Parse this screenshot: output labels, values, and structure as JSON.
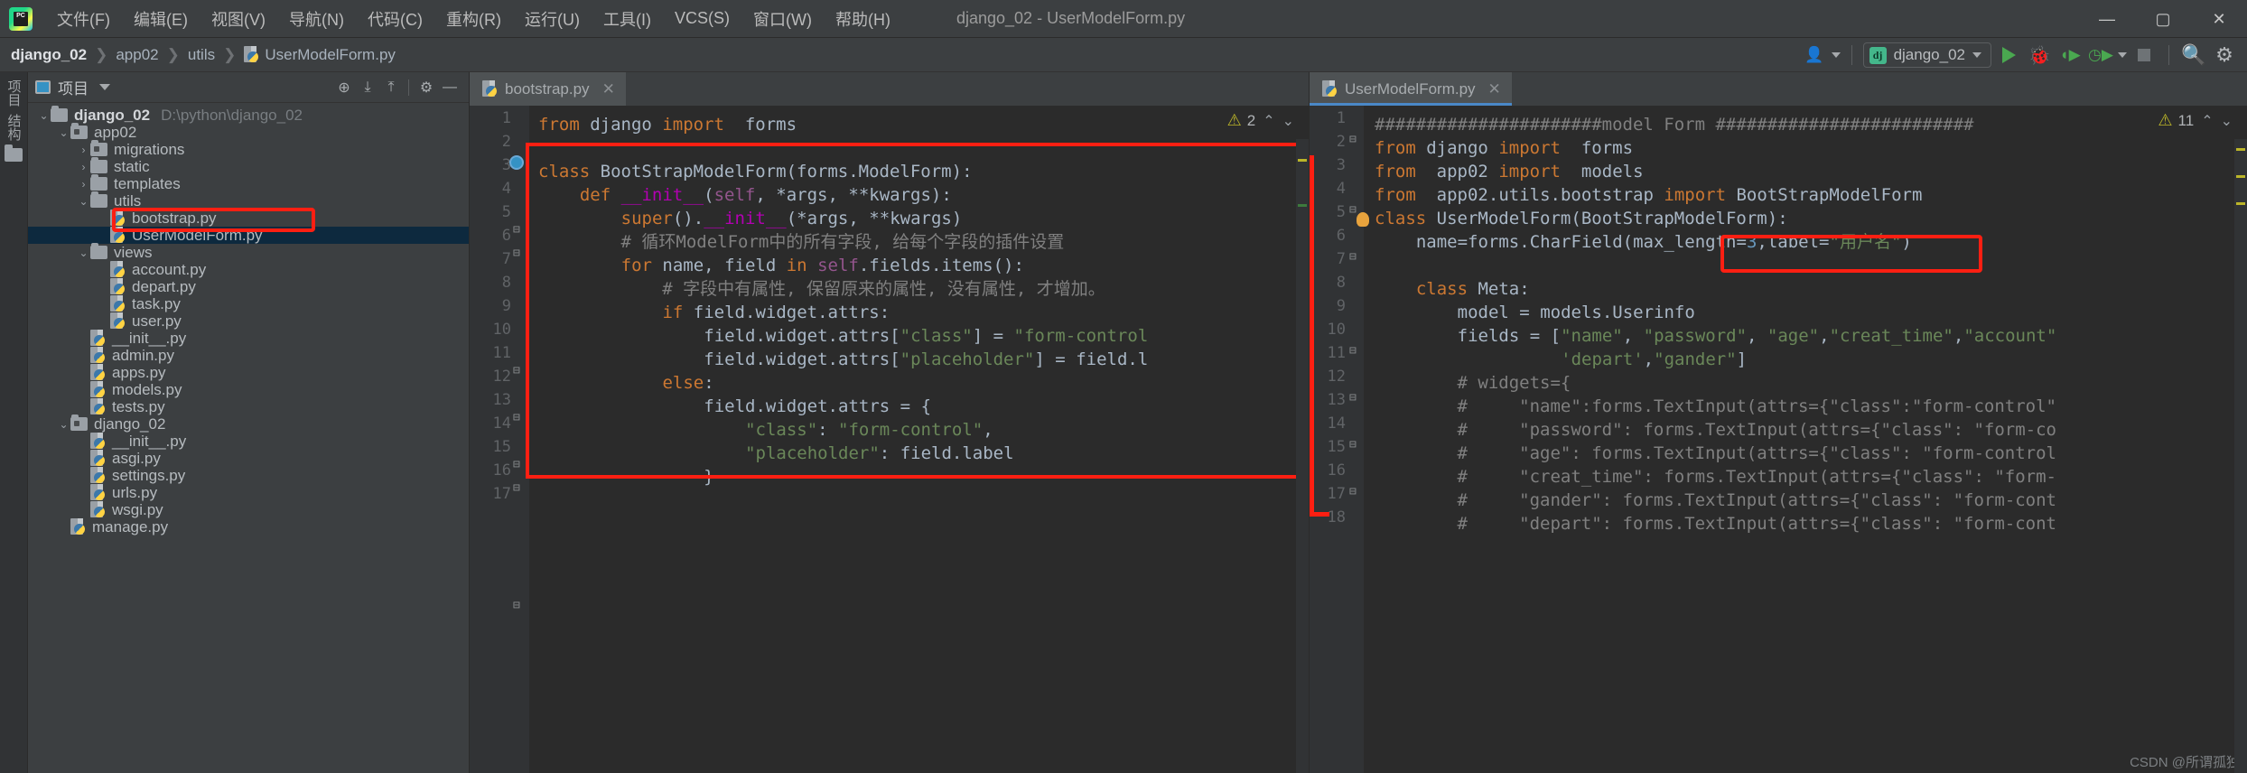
{
  "window": {
    "title": "django_02 - UserModelForm.py",
    "minimize": "—",
    "maximize": "▢",
    "close": "✕"
  },
  "menubar": {
    "logo_text": "PC",
    "items": [
      "文件(F)",
      "编辑(E)",
      "视图(V)",
      "导航(N)",
      "代码(C)",
      "重构(R)",
      "运行(U)",
      "工具(I)",
      "VCS(S)",
      "窗口(W)",
      "帮助(H)"
    ]
  },
  "breadcrumb": {
    "project": "django_02",
    "app": "app02",
    "folder": "utils",
    "file": "UserModelForm.py",
    "separator": "❯"
  },
  "toolbar": {
    "account_icon": "user-icon",
    "run_config": {
      "badge": "dj",
      "label": "django_02",
      "dropdown_icon": "chevron-down-icon"
    },
    "run_icon": "run-play-icon",
    "debug_icon": "debug-bug-icon",
    "coverage_icon": "run-coverage-icon",
    "profile_icon": "profile-icon",
    "more_icon": "chevron-down-icon",
    "stop_icon": "stop-square-icon",
    "search_icon": "search-icon",
    "settings_icon": "gear-icon"
  },
  "left_strip": {
    "project_tab": "项目",
    "structure_tab": "结构",
    "favorites_icon": "folder-icon"
  },
  "project_panel": {
    "title": "项目",
    "dropdown_icon": "chevron-down-icon",
    "actions": [
      "locate-icon",
      "expand-all-icon",
      "collapse-all-icon",
      "gear-icon",
      "minimize-icon"
    ],
    "tree": [
      {
        "label": "django_02",
        "path": "D:\\python\\django_02",
        "depth": 0,
        "arrow": "down",
        "icon": "folder",
        "bold": true
      },
      {
        "label": "app02",
        "path": "",
        "depth": 1,
        "arrow": "down",
        "icon": "module-folder",
        "bold": false
      },
      {
        "label": "migrations",
        "path": "",
        "depth": 2,
        "arrow": "right",
        "icon": "module-folder",
        "bold": false
      },
      {
        "label": "static",
        "path": "",
        "depth": 2,
        "arrow": "right",
        "icon": "folder",
        "bold": false
      },
      {
        "label": "templates",
        "path": "",
        "depth": 2,
        "arrow": "right",
        "icon": "folder",
        "bold": false
      },
      {
        "label": "utils",
        "path": "",
        "depth": 2,
        "arrow": "down",
        "icon": "folder",
        "bold": false
      },
      {
        "label": "bootstrap.py",
        "path": "",
        "depth": 3,
        "arrow": "none",
        "icon": "python",
        "bold": false,
        "highlight": true
      },
      {
        "label": "UserModelForm.py",
        "path": "",
        "depth": 3,
        "arrow": "none",
        "icon": "python",
        "bold": false,
        "selected": true
      },
      {
        "label": "views",
        "path": "",
        "depth": 2,
        "arrow": "down",
        "icon": "folder",
        "bold": false
      },
      {
        "label": "account.py",
        "path": "",
        "depth": 3,
        "arrow": "none",
        "icon": "python",
        "bold": false
      },
      {
        "label": "depart.py",
        "path": "",
        "depth": 3,
        "arrow": "none",
        "icon": "python",
        "bold": false
      },
      {
        "label": "task.py",
        "path": "",
        "depth": 3,
        "arrow": "none",
        "icon": "python",
        "bold": false
      },
      {
        "label": "user.py",
        "path": "",
        "depth": 3,
        "arrow": "none",
        "icon": "python",
        "bold": false
      },
      {
        "label": "__init__.py",
        "path": "",
        "depth": 2,
        "arrow": "none",
        "icon": "python",
        "bold": false
      },
      {
        "label": "admin.py",
        "path": "",
        "depth": 2,
        "arrow": "none",
        "icon": "python",
        "bold": false
      },
      {
        "label": "apps.py",
        "path": "",
        "depth": 2,
        "arrow": "none",
        "icon": "python",
        "bold": false
      },
      {
        "label": "models.py",
        "path": "",
        "depth": 2,
        "arrow": "none",
        "icon": "python",
        "bold": false
      },
      {
        "label": "tests.py",
        "path": "",
        "depth": 2,
        "arrow": "none",
        "icon": "python",
        "bold": false
      },
      {
        "label": "django_02",
        "path": "",
        "depth": 1,
        "arrow": "down",
        "icon": "module-folder",
        "bold": false
      },
      {
        "label": "__init__.py",
        "path": "",
        "depth": 2,
        "arrow": "none",
        "icon": "python",
        "bold": false
      },
      {
        "label": "asgi.py",
        "path": "",
        "depth": 2,
        "arrow": "none",
        "icon": "python",
        "bold": false
      },
      {
        "label": "settings.py",
        "path": "",
        "depth": 2,
        "arrow": "none",
        "icon": "python",
        "bold": false
      },
      {
        "label": "urls.py",
        "path": "",
        "depth": 2,
        "arrow": "none",
        "icon": "python",
        "bold": false
      },
      {
        "label": "wsgi.py",
        "path": "",
        "depth": 2,
        "arrow": "none",
        "icon": "python",
        "bold": false
      },
      {
        "label": "manage.py",
        "path": "",
        "depth": 1,
        "arrow": "none",
        "icon": "python",
        "bold": false
      }
    ]
  },
  "editor_left": {
    "tab_label": "bootstrap.py",
    "tab_close": "✕",
    "warning_icon": "warning-triangle-icon",
    "warning_count": "2",
    "nav_up": "⌃",
    "nav_down": "⌄",
    "lines": [
      {
        "n": 1,
        "text": "from django import  forms"
      },
      {
        "n": 2,
        "text": ""
      },
      {
        "n": 3,
        "text": "class BootStrapModelForm(forms.ModelForm):"
      },
      {
        "n": 4,
        "text": "    def __init__(self, *args, **kwargs):"
      },
      {
        "n": 5,
        "text": "        super().__init__(*args, **kwargs)"
      },
      {
        "n": 6,
        "text": "        # 循环ModelForm中的所有字段, 给每个字段的插件设置"
      },
      {
        "n": 7,
        "text": "        for name, field in self.fields.items():"
      },
      {
        "n": 8,
        "text": "            # 字段中有属性, 保留原来的属性, 没有属性, 才增加。"
      },
      {
        "n": 9,
        "text": "            if field.widget.attrs:"
      },
      {
        "n": 10,
        "text": "                field.widget.attrs[\"class\"] = \"form-control"
      },
      {
        "n": 11,
        "text": "                field.widget.attrs[\"placeholder\"] = field.l"
      },
      {
        "n": 12,
        "text": "            else:"
      },
      {
        "n": 13,
        "text": "                field.widget.attrs = {"
      },
      {
        "n": 14,
        "text": "                    \"class\": \"form-control\","
      },
      {
        "n": 15,
        "text": "                    \"placeholder\": field.label"
      },
      {
        "n": 16,
        "text": "                }"
      },
      {
        "n": 17,
        "text": ""
      }
    ]
  },
  "editor_right": {
    "tab_label": "UserModelForm.py",
    "tab_close": "✕",
    "warning_icon": "warning-triangle-icon",
    "warning_count": "11",
    "nav_up": "⌃",
    "nav_down": "⌄",
    "lines": [
      {
        "n": 1,
        "text": "######################model Form #########################"
      },
      {
        "n": 2,
        "text": "from django import  forms"
      },
      {
        "n": 3,
        "text": "from  app02 import  models"
      },
      {
        "n": 4,
        "text": "from  app02.utils.bootstrap import BootStrapModelForm"
      },
      {
        "n": 5,
        "text": "class UserModelForm(BootStrapModelForm):"
      },
      {
        "n": 6,
        "text": "    name=forms.CharField(max_length=3,label=\"用户名\")"
      },
      {
        "n": 7,
        "text": ""
      },
      {
        "n": 8,
        "text": "    class Meta:"
      },
      {
        "n": 9,
        "text": "        model = models.Userinfo"
      },
      {
        "n": 10,
        "text": "        fields = [\"name\", \"password\", \"age\",\"creat_time\",\"account\""
      },
      {
        "n": 11,
        "text": "                  'depart',\"gander\"]"
      },
      {
        "n": 12,
        "text": "        # widgets={"
      },
      {
        "n": 13,
        "text": "        #     \"name\":forms.TextInput(attrs={\"class\":\"form-control\""
      },
      {
        "n": 14,
        "text": "        #     \"password\": forms.TextInput(attrs={\"class\": \"form-co"
      },
      {
        "n": 15,
        "text": "        #     \"age\": forms.TextInput(attrs={\"class\": \"form-control"
      },
      {
        "n": 16,
        "text": "        #     \"creat_time\": forms.TextInput(attrs={\"class\": \"form-"
      },
      {
        "n": 17,
        "text": "        #     \"gander\": forms.TextInput(attrs={\"class\": \"form-cont"
      },
      {
        "n": 18,
        "text": "        #     \"depart\": forms.TextInput(attrs={\"class\": \"form-cont"
      }
    ]
  },
  "annotations": {
    "left_highlight_label": "red-rect-bootstrap-class",
    "right_highlight_label": "red-rect-bootstrap-parent",
    "tree_highlight_label": "red-rect-bootstrap-file"
  },
  "watermark": "CSDN @所谓孤独",
  "colors": {
    "accent_red": "#fd1f12",
    "editor_bg": "#2b2b2b",
    "panel_bg": "#3c3f41",
    "gutter_bg": "#313335",
    "selection_blue": "#0d293e",
    "tab_active": "#4e5254",
    "keyword_orange": "#cc7832",
    "string_green": "#6a8759",
    "comment_gray": "#808080",
    "number_blue": "#6897bb",
    "warning_yellow": "#bbb529"
  }
}
